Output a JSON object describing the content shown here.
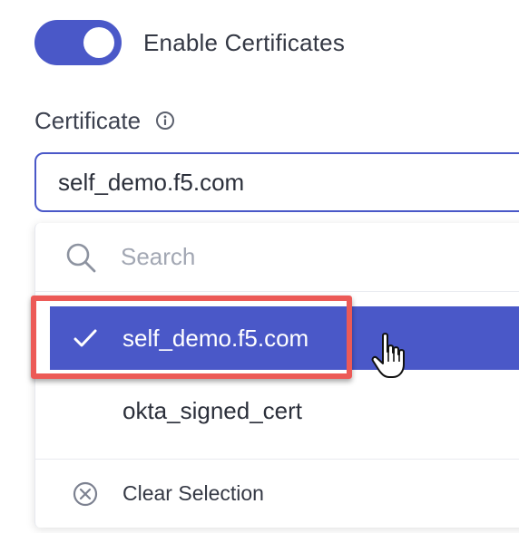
{
  "toggle": {
    "label": "Enable Certificates",
    "state": "on",
    "accent_color": "#4a58c8"
  },
  "certificate": {
    "label": "Certificate",
    "info_icon": "info-icon",
    "selected_value": "self_demo.f5.com"
  },
  "dropdown": {
    "search": {
      "placeholder": "Search",
      "icon": "search-icon"
    },
    "options": [
      {
        "label": "self_demo.f5.com",
        "selected": true,
        "icon": "check-icon"
      },
      {
        "label": "okta_signed_cert",
        "selected": false
      }
    ],
    "clear": {
      "label": "Clear Selection",
      "icon": "clear-circle-icon"
    }
  },
  "annotation": {
    "highlight_color": "#ec5a57",
    "cursor": "hand-pointer-icon"
  }
}
